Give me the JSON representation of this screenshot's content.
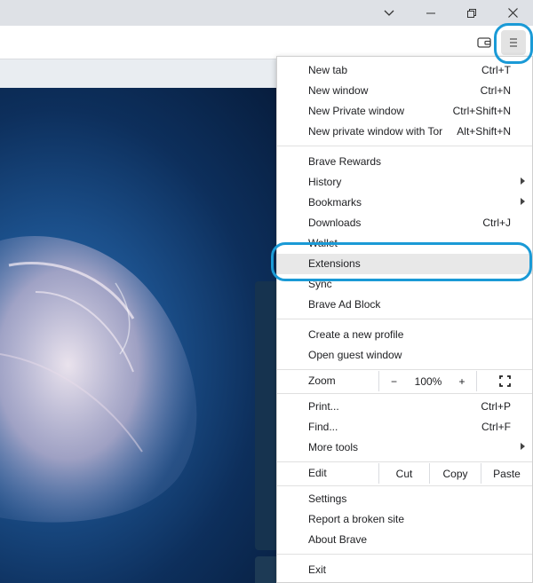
{
  "window_controls": {
    "dropdown": "chevron-down-icon",
    "minimize": "minimize-icon",
    "restore": "restore-icon",
    "close": "close-icon"
  },
  "toolbar": {
    "wallet_icon": "wallet-icon",
    "menu_icon": "hamburger-menu-icon"
  },
  "menu": {
    "new_tab": {
      "label": "New tab",
      "shortcut": "Ctrl+T"
    },
    "new_window": {
      "label": "New window",
      "shortcut": "Ctrl+N"
    },
    "new_private": {
      "label": "New Private window",
      "shortcut": "Ctrl+Shift+N"
    },
    "new_tor": {
      "label": "New private window with Tor",
      "shortcut": "Alt+Shift+N"
    },
    "rewards": {
      "label": "Brave Rewards"
    },
    "history": {
      "label": "History"
    },
    "bookmarks": {
      "label": "Bookmarks"
    },
    "downloads": {
      "label": "Downloads",
      "shortcut": "Ctrl+J"
    },
    "wallet": {
      "label": "Wallet"
    },
    "extensions": {
      "label": "Extensions"
    },
    "sync": {
      "label": "Sync"
    },
    "adblock": {
      "label": "Brave Ad Block"
    },
    "new_profile": {
      "label": "Create a new profile"
    },
    "guest": {
      "label": "Open guest window"
    },
    "zoom": {
      "label": "Zoom",
      "minus": "−",
      "value": "100%",
      "plus": "+",
      "fullscreen_icon": "fullscreen-icon"
    },
    "print": {
      "label": "Print...",
      "shortcut": "Ctrl+P"
    },
    "find": {
      "label": "Find...",
      "shortcut": "Ctrl+F"
    },
    "more_tools": {
      "label": "More tools"
    },
    "edit": {
      "label": "Edit",
      "cut": "Cut",
      "copy": "Copy",
      "paste": "Paste"
    },
    "settings": {
      "label": "Settings"
    },
    "report": {
      "label": "Report a broken site"
    },
    "about": {
      "label": "About Brave"
    },
    "exit": {
      "label": "Exit"
    }
  },
  "colors": {
    "highlight_ring": "#1a9ad6",
    "menu_hover": "#e8e8e8"
  }
}
